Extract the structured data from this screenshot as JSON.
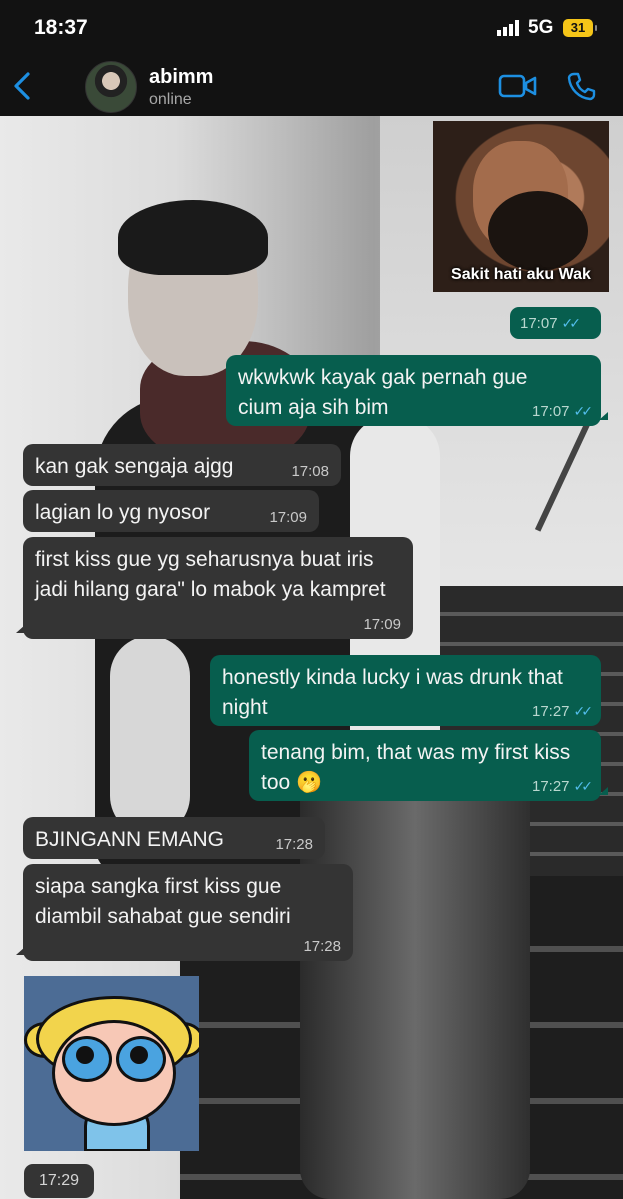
{
  "status_bar": {
    "time": "18:37",
    "network": "5G",
    "battery": "31"
  },
  "header": {
    "contact_name": "abimm",
    "contact_status": "online"
  },
  "sticker_top": {
    "caption": "Sakit hati aku Wak",
    "time": "17:07"
  },
  "messages": [
    {
      "text": "wkwkwk kayak gak pernah gue cium aja sih bim",
      "time": "17:07"
    },
    {
      "text": "kan gak sengaja ajgg",
      "time": "17:08"
    },
    {
      "text": "lagian lo yg nyosor",
      "time": "17:09"
    },
    {
      "text": "first kiss gue yg seharusnya buat iris jadi hilang gara\" lo mabok ya kampret",
      "time": "17:09"
    },
    {
      "text": "honestly kinda lucky i was drunk that night",
      "time": "17:27"
    },
    {
      "text": "tenang bim, that was my first kiss too 🫢",
      "time": "17:27"
    },
    {
      "text": "BJINGANN EMANG",
      "time": "17:28"
    },
    {
      "text": "siapa sangka first kiss gue diambil sahabat gue sendiri",
      "time": "17:28"
    }
  ],
  "sticker_bottom": {
    "time": "17:29"
  },
  "colors": {
    "incoming": "#343434",
    "outgoing": "#075e4e",
    "tick": "#53bdeb",
    "accent": "#1d8fe1"
  },
  "icons": {
    "back": "chevron-left-icon",
    "video": "video-call-icon",
    "call": "phone-icon",
    "read": "double-check-icon"
  }
}
